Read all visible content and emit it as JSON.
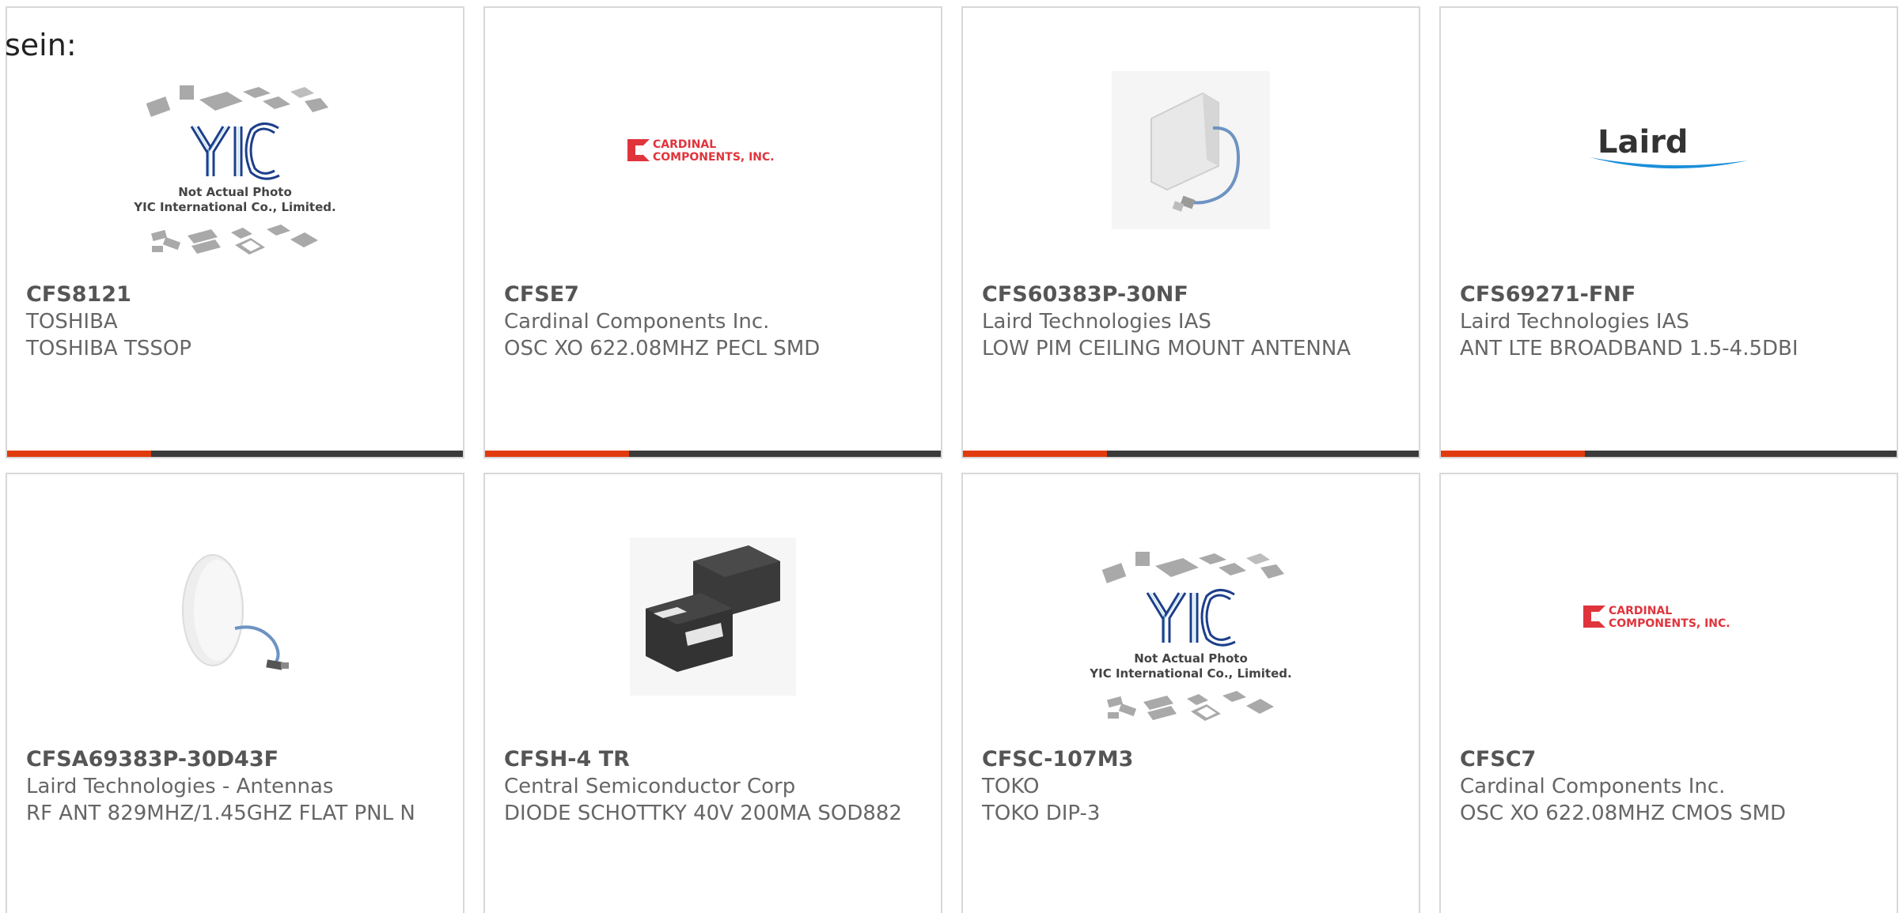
{
  "intro_text": "sein:",
  "colors": {
    "accent": "#e23a0f",
    "bar": "#3a3a3a",
    "border": "#d8d8d8",
    "cardinal_red": "#e0343c",
    "laird_blue": "#1b8fd8"
  },
  "products": [
    {
      "part": "CFS8121",
      "manufacturer": "TOSHIBA",
      "description": "TOSHIBA TSSOP",
      "image": "yic-placeholder",
      "image_text": {
        "line1": "Not Actual Photo",
        "line2": "YIC International Co., Limited."
      }
    },
    {
      "part": "CFSE7",
      "manufacturer": "Cardinal Components Inc.",
      "description": "OSC XO 622.08MHZ PECL SMD",
      "image": "cardinal-logo",
      "image_text": {
        "line1": "CARDINAL",
        "line2": "COMPONENTS, INC."
      }
    },
    {
      "part": "CFS60383P-30NF",
      "manufacturer": "Laird Technologies IAS",
      "description": "LOW PIM CEILING MOUNT ANTENNA",
      "image": "panel-antenna-photo"
    },
    {
      "part": "CFS69271-FNF",
      "manufacturer": "Laird Technologies IAS",
      "description": "ANT LTE BROADBAND 1.5-4.5DBI",
      "image": "laird-logo",
      "image_text": {
        "line1": "Laird"
      }
    },
    {
      "part": "CFSA69383P-30D43F",
      "manufacturer": "Laird Technologies - Antennas",
      "description": "RF ANT 829MHZ/1.45GHZ FLAT PNL N",
      "image": "dome-antenna-photo"
    },
    {
      "part": "CFSH-4 TR",
      "manufacturer": "Central Semiconductor Corp",
      "description": "DIODE SCHOTTKY 40V 200MA SOD882",
      "image": "diode-package-photo"
    },
    {
      "part": "CFSC-107M3",
      "manufacturer": "TOKO",
      "description": "TOKO DIP-3",
      "image": "yic-placeholder",
      "image_text": {
        "line1": "Not Actual Photo",
        "line2": "YIC International Co., Limited."
      }
    },
    {
      "part": "CFSC7",
      "manufacturer": "Cardinal Components Inc.",
      "description": "OSC XO 622.08MHZ CMOS SMD",
      "image": "cardinal-logo",
      "image_text": {
        "line1": "CARDINAL",
        "line2": "COMPONENTS, INC."
      }
    }
  ]
}
